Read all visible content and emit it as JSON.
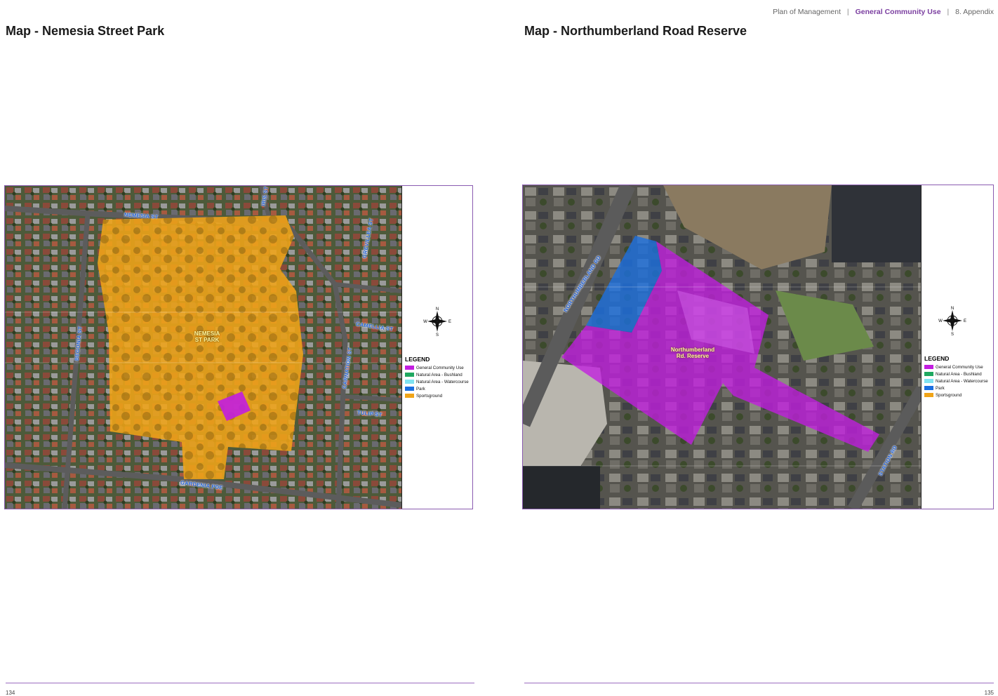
{
  "header": {
    "breadcrumb": {
      "doc": "Plan of Management",
      "section": "General Community Use",
      "chapter": "8. Appendix"
    }
  },
  "left_page": {
    "title": "Map - Nemesia Street Park",
    "page_number": "134",
    "area_label": "NEMESIA\nST PARK",
    "streets": [
      "NEMESIA ST",
      "CAMELLIA ST",
      "TULIP ST",
      "GARDENIA PDE",
      "CARNATION ST",
      "BEGONIA ST",
      "GREVILLEA ST",
      "IRIS ST"
    ]
  },
  "right_page": {
    "title": "Map - Northumberland Road Reserve",
    "page_number": "135",
    "area_label": "Northumberland\nRd. Reserve",
    "streets": [
      "NORTHUMBERLAND RD",
      "STATION RD"
    ]
  },
  "legend": {
    "title": "LEGEND",
    "items": [
      {
        "label": "General Community Use",
        "color": "#c21ee0"
      },
      {
        "label": "Natural Area - Bushland",
        "color": "#1fa860"
      },
      {
        "label": "Natural Area - Watercourse",
        "color": "#7fe3f2"
      },
      {
        "label": "Park",
        "color": "#1b6fe0"
      },
      {
        "label": "Sportsground",
        "color": "#f0a418"
      }
    ]
  },
  "compass": {
    "n": "N",
    "s": "S",
    "e": "E",
    "w": "W"
  },
  "colors": {
    "accent": "#7b3fa0",
    "frame": "#8a5bb0",
    "sportsground": "#f0a418",
    "general_community": "#c21ee0",
    "park": "#1b6fe0"
  }
}
